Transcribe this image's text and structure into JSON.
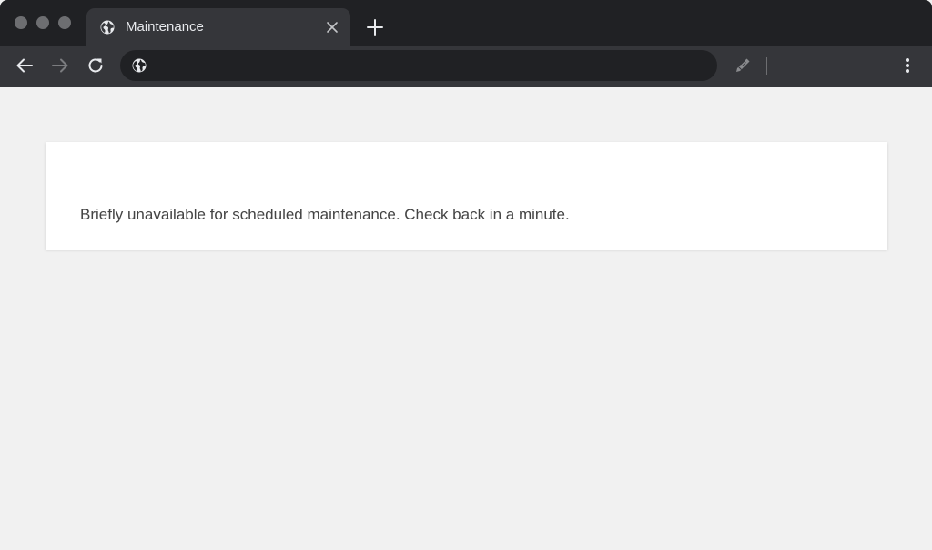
{
  "tab": {
    "title": "Maintenance",
    "favicon_icon": "globe-icon",
    "close_icon": "close-icon"
  },
  "toolbar": {
    "new_tab_icon": "plus-icon",
    "back_icon": "arrow-left-icon",
    "forward_icon": "arrow-right-icon",
    "reload_icon": "reload-icon",
    "extension_icon": "pencil-icon",
    "menu_icon": "kebab-menu-icon"
  },
  "omnibox": {
    "value": "",
    "site_icon": "globe-icon"
  },
  "page": {
    "message": "Briefly unavailable for scheduled maintenance. Check back in a minute."
  },
  "colors": {
    "tabstrip": "#202124",
    "toolbar": "#35363a",
    "page_background": "#f1f1f1",
    "card": "#ffffff",
    "text": "#444444"
  }
}
